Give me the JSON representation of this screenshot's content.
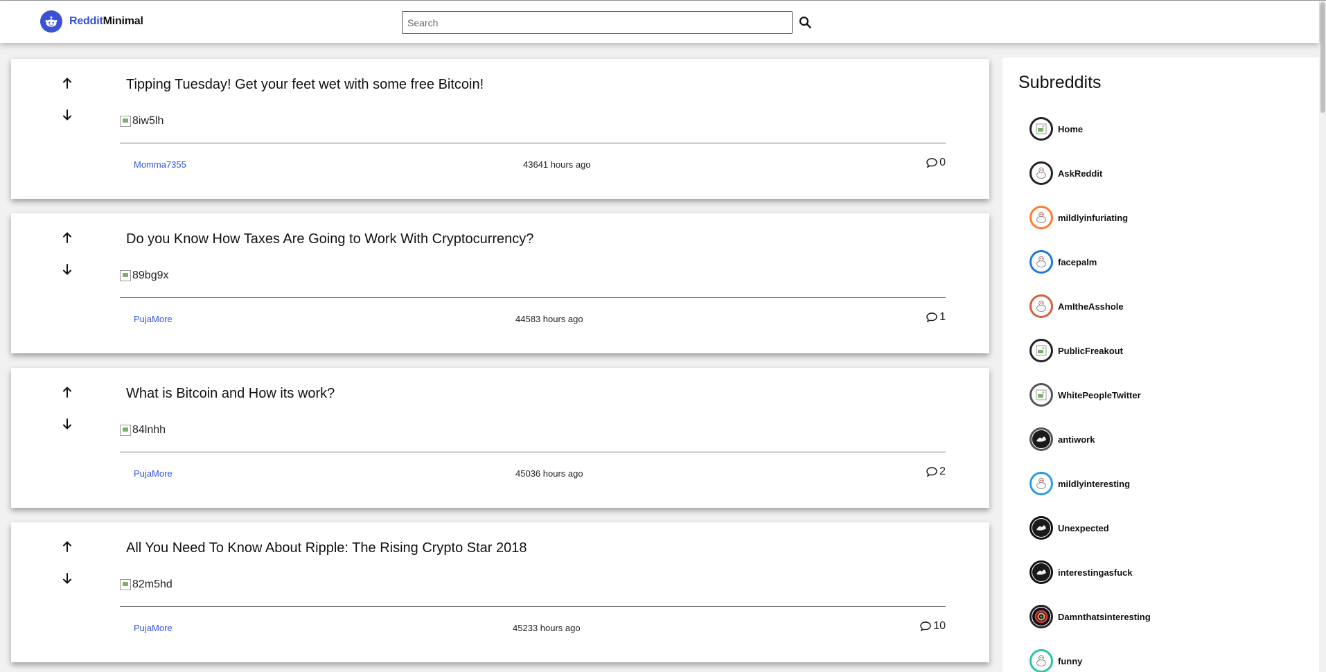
{
  "header": {
    "logo_part1": "Reddit",
    "logo_part2": "Minimal",
    "search_placeholder": "Search",
    "search_icon": "search-icon",
    "brand_color": "#3450d6"
  },
  "posts": [
    {
      "title": "Tipping Tuesday! Get your feet wet with some free Bitcoin!",
      "image_alt": "8iw5lh",
      "author": "Momma7355",
      "time": "43641 hours ago",
      "comments": "0"
    },
    {
      "title": "Do you Know How Taxes Are Going to Work With Cryptocurrency?",
      "image_alt": "89bg9x",
      "author": "PujaMore",
      "time": "44583 hours ago",
      "comments": "1"
    },
    {
      "title": "What is Bitcoin and How its work?",
      "image_alt": "84lnhh",
      "author": "PujaMore",
      "time": "45036 hours ago",
      "comments": "2"
    },
    {
      "title": "All You Need To Know About Ripple: The Rising Crypto Star 2018",
      "image_alt": "82m5hd",
      "author": "PujaMore",
      "time": "45233 hours ago",
      "comments": "10"
    }
  ],
  "sidebar": {
    "title": "Subreddits",
    "items": [
      {
        "label": "Home",
        "border": "#222222",
        "icon": "broken-image"
      },
      {
        "label": "AskReddit",
        "border": "#222222",
        "icon": "snoo"
      },
      {
        "label": "mildlyinfuriating",
        "border": "#ff7a33",
        "icon": "snoo"
      },
      {
        "label": "facepalm",
        "border": "#1e78d6",
        "icon": "snoo"
      },
      {
        "label": "AmItheAsshole",
        "border": "#d6603a",
        "icon": "snoo"
      },
      {
        "label": "PublicFreakout",
        "border": "#222222",
        "icon": "broken-image"
      },
      {
        "label": "WhitePeopleTwitter",
        "border": "#555555",
        "icon": "broken-image"
      },
      {
        "label": "antiwork",
        "border": "#555555",
        "icon": "dark-blob"
      },
      {
        "label": "mildlyinteresting",
        "border": "#2a9be0",
        "icon": "snoo"
      },
      {
        "label": "Unexpected",
        "border": "#111111",
        "icon": "dark-blob"
      },
      {
        "label": "interestingasfuck",
        "border": "#111111",
        "icon": "dark-blob"
      },
      {
        "label": "Damnthatsinteresting",
        "border": "#222222",
        "icon": "colorful-swirl"
      },
      {
        "label": "funny",
        "border": "#2bc3a6",
        "icon": "snoo"
      }
    ]
  }
}
